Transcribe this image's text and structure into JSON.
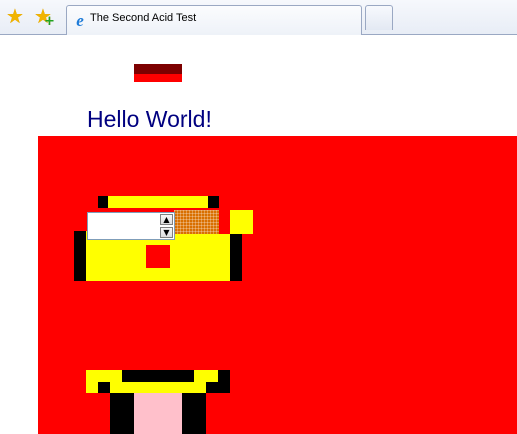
{
  "browser": {
    "tab_title": "The Second Acid Test",
    "tab_icon": "ie-icon",
    "new_tab_icon": "new-tab-icon",
    "favorites_icon": "favorites-star-icon",
    "add_favorites_icon": "add-favorites-icon"
  },
  "page": {
    "heading": "Hello World!"
  },
  "controls": {
    "spinner_up_icon": "up-arrow-icon",
    "spinner_down_icon": "down-arrow-icon"
  }
}
